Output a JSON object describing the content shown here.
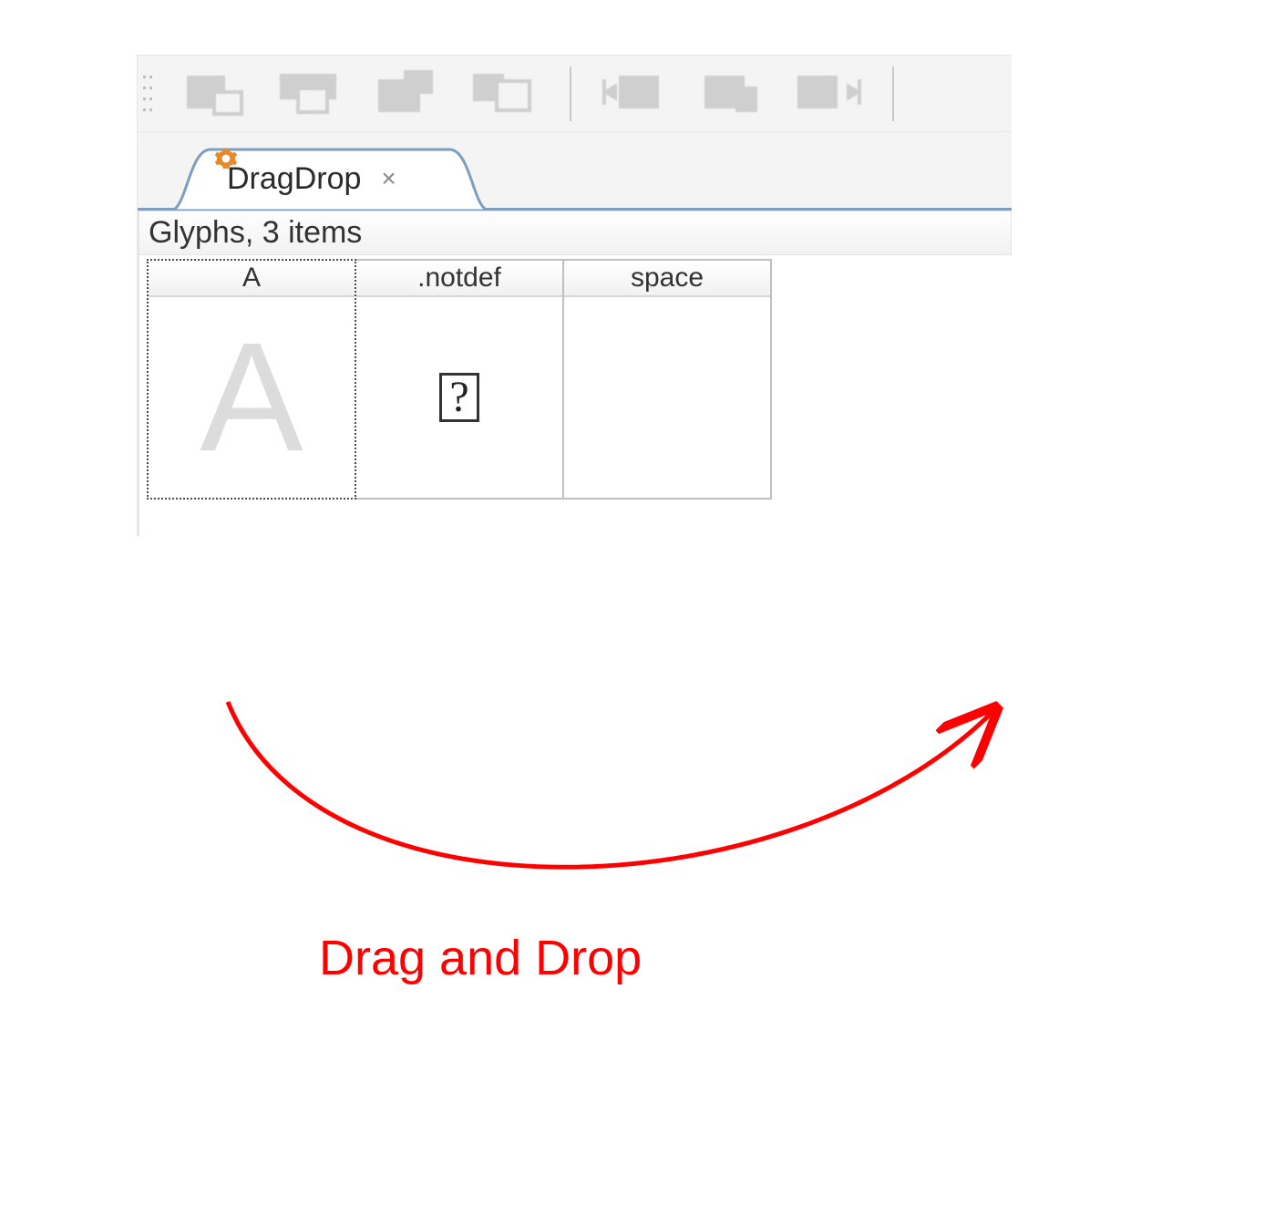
{
  "tab": {
    "title": "DragDrop",
    "close_glyph": "×",
    "icon_name": "gear-icon"
  },
  "section": {
    "header": "Glyphs, 3 items"
  },
  "glyphs": [
    {
      "name": "A",
      "preview": "A",
      "selected": true
    },
    {
      "name": ".notdef",
      "preview": "?",
      "selected": false
    },
    {
      "name": "space",
      "preview": "",
      "selected": false
    }
  ],
  "annotation": {
    "label": "Drag and Drop"
  },
  "colors": {
    "tab_border": "#7d9ebf",
    "accent_gear": "#e58a2b",
    "annotation": "#ff0000"
  }
}
